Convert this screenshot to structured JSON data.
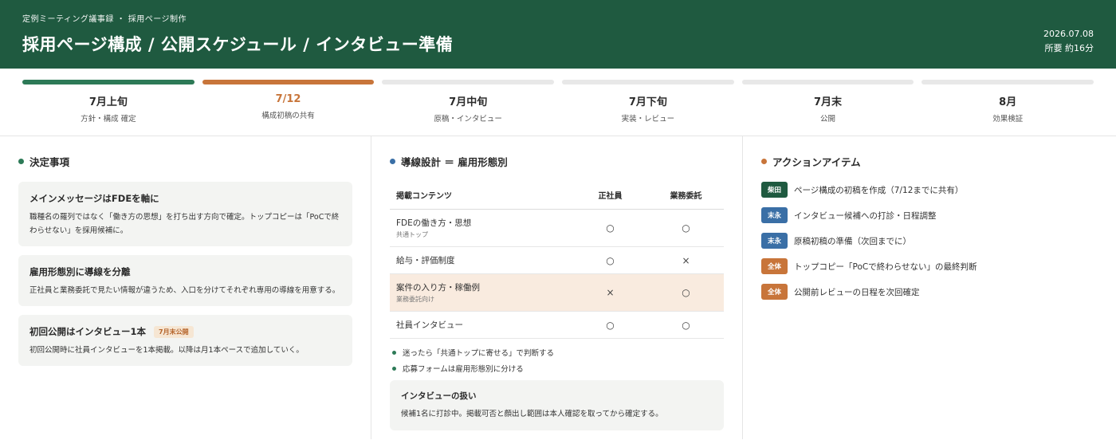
{
  "header": {
    "breadcrumb": "定例ミーティング議事録 ・ 採用ページ制作",
    "title": "採用ページ構成 / 公開スケジュール / インタビュー準備",
    "date": "2026.07.08",
    "duration": "所要 約16分"
  },
  "timeline": [
    {
      "label": "7月上旬",
      "sub": "方針・構成 確定",
      "status": "done"
    },
    {
      "label": "7/12",
      "sub": "構成初稿の共有",
      "status": "current"
    },
    {
      "label": "7月中旬",
      "sub": "原稿・インタビュー",
      "status": "upcoming"
    },
    {
      "label": "7月下旬",
      "sub": "実装・レビュー",
      "status": "upcoming"
    },
    {
      "label": "7月末",
      "sub": "公開",
      "status": "upcoming"
    },
    {
      "label": "8月",
      "sub": "効果検証",
      "status": "upcoming"
    }
  ],
  "decisions": {
    "title": "決定事項",
    "cards": [
      {
        "title": "メインメッセージはFDEを軸に",
        "body": "職種名の羅列ではなく「働き方の思想」を打ち出す方向で確定。トップコピーは「PoCで終わらせない」を採用候補に。",
        "tag": ""
      },
      {
        "title": "雇用形態別に導線を分離",
        "body": "正社員と業務委託で見たい情報が違うため、入口を分けてそれぞれ専用の導線を用意する。",
        "tag": ""
      },
      {
        "title": "初回公開はインタビュー1本",
        "body": "初回公開時に社員インタビューを1本掲載。以降は月1本ペースで追加していく。",
        "tag": "7月末公開"
      }
    ]
  },
  "flow": {
    "title": "導線設計 ＝ 雇用形態別",
    "headers": [
      "掲載コンテンツ",
      "正社員",
      "業務委託"
    ],
    "rows": [
      {
        "name": "FDEの働き方・思想",
        "sub": "共通トップ",
        "a": "○",
        "b": "○",
        "highlight": false
      },
      {
        "name": "給与・評価制度",
        "sub": "",
        "a": "○",
        "b": "×",
        "highlight": false
      },
      {
        "name": "案件の入り方・稼働例",
        "sub": "業務委託向け",
        "a": "×",
        "b": "○",
        "highlight": true
      },
      {
        "name": "社員インタビュー",
        "sub": "",
        "a": "○",
        "b": "○",
        "highlight": false
      }
    ],
    "notes": [
      "迷ったら「共通トップに寄せる」で判断する",
      "応募フォームは雇用形態別に分ける"
    ],
    "interview": {
      "title": "インタビューの扱い",
      "body": "候補1名に打診中。掲載可否と顔出し範囲は本人確認を取ってから確定する。"
    }
  },
  "actions": {
    "title": "アクションアイテム",
    "items": [
      {
        "owner": "柴田",
        "color": "green",
        "text": "ページ構成の初稿を作成（7/12までに共有）"
      },
      {
        "owner": "末永",
        "color": "blue",
        "text": "インタビュー候補への打診・日程調整"
      },
      {
        "owner": "末永",
        "color": "blue",
        "text": "原稿初稿の準備（次回までに）"
      },
      {
        "owner": "全体",
        "color": "orange",
        "text": "トップコピー「PoCで終わらせない」の最終判断"
      },
      {
        "owner": "全体",
        "color": "orange",
        "text": "公開前レビューの日程を次回確定"
      }
    ]
  },
  "colors": {
    "header": "#1f5a40",
    "done": "#2d7a57",
    "current": "#c8753a",
    "blue": "#3a6fa6"
  }
}
